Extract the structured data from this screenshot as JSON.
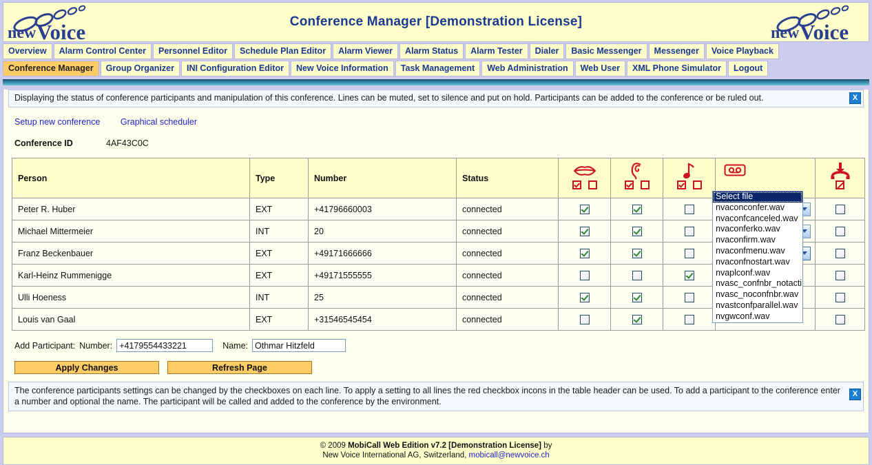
{
  "header": {
    "title": "Conference Manager [Demonstration License]",
    "logo_text_left": "new",
    "logo_text_right": "Voice",
    "logo_alt": "newVoice"
  },
  "nav": {
    "row1": [
      {
        "label": "Overview",
        "active": false
      },
      {
        "label": "Alarm Control Center",
        "active": false
      },
      {
        "label": "Personnel Editor",
        "active": false
      },
      {
        "label": "Schedule Plan Editor",
        "active": false
      },
      {
        "label": "Alarm Viewer",
        "active": false
      },
      {
        "label": "Alarm Status",
        "active": false
      },
      {
        "label": "Alarm Tester",
        "active": false
      },
      {
        "label": "Dialer",
        "active": false
      },
      {
        "label": "Basic Messenger",
        "active": false
      },
      {
        "label": "Messenger",
        "active": false
      },
      {
        "label": "Voice Playback",
        "active": false
      }
    ],
    "row2": [
      {
        "label": "Conference Manager",
        "active": true
      },
      {
        "label": "Group Organizer",
        "active": false
      },
      {
        "label": "INI Configuration Editor",
        "active": false
      },
      {
        "label": "New Voice Information",
        "active": false
      },
      {
        "label": "Task Management",
        "active": false
      },
      {
        "label": "Web Administration",
        "active": false
      },
      {
        "label": "Web User",
        "active": false
      },
      {
        "label": "XML Phone Simulator",
        "active": false
      },
      {
        "label": "Logout",
        "active": false
      }
    ]
  },
  "info_banner": {
    "text": "Displaying the status of conference participants and manipulation of this conference. Lines can be muted, set to silence and put on hold. Participants can be added to the conference or be ruled out.",
    "close_label": "X"
  },
  "links": {
    "setup_new_conference": "Setup new conference",
    "graphical_scheduler": "Graphical scheduler"
  },
  "conference": {
    "id_label": "Conference ID",
    "id_value": "4AF43C0C"
  },
  "table": {
    "columns": [
      "Person",
      "Type",
      "Number",
      "Status"
    ],
    "icon_columns": [
      {
        "name": "mouth-icon",
        "title": "mute",
        "boxes": [
          "checked",
          "empty"
        ]
      },
      {
        "name": "ear-icon",
        "title": "silence",
        "boxes": [
          "checked",
          "empty"
        ]
      },
      {
        "name": "music-note-icon",
        "title": "hold",
        "boxes": [
          "checked",
          "empty"
        ]
      },
      {
        "name": "cassette-tape-icon",
        "title": "play file",
        "boxes": []
      },
      {
        "name": "hangup-phone-icon",
        "title": "rule out",
        "boxes": [
          "slash"
        ]
      }
    ],
    "rows": [
      {
        "person": "Peter R. Huber",
        "type": "EXT",
        "number": "+41796660003",
        "status": "connected",
        "mute": true,
        "silence": true,
        "hold": false,
        "file": "Select file",
        "hangup": false
      },
      {
        "person": "Michael Mittermeier",
        "type": "INT",
        "number": "20",
        "status": "connected",
        "mute": true,
        "silence": true,
        "hold": false,
        "file": "Select file",
        "hangup": false
      },
      {
        "person": "Franz Beckenbauer",
        "type": "EXT",
        "number": "+49171666666",
        "status": "connected",
        "mute": true,
        "silence": true,
        "hold": false,
        "file": "Select file",
        "hangup": false
      },
      {
        "person": "Karl-Heinz Rummenigge",
        "type": "EXT",
        "number": "+49171555555",
        "status": "connected",
        "mute": false,
        "silence": false,
        "hold": true,
        "file": "Select file",
        "hangup": false
      },
      {
        "person": "Ulli Hoeness",
        "type": "INT",
        "number": "25",
        "status": "connected",
        "mute": true,
        "silence": true,
        "hold": false,
        "file": "Select file",
        "hangup": false
      },
      {
        "person": "Louis van Gaal",
        "type": "EXT",
        "number": "+31546545454",
        "status": "connected",
        "mute": false,
        "silence": true,
        "hold": false,
        "file": "Select file",
        "hangup": false
      }
    ]
  },
  "file_dropdown": {
    "open_on_row": 3,
    "selected": "Select file",
    "options": [
      "Select file",
      "nvaconconfer.wav",
      "nvaconfcanceled.wav",
      "nvaconferko.wav",
      "nvaconfirm.wav",
      "nvaconfmenu.wav",
      "nvaconfnostart.wav",
      "nvaplconf.wav",
      "nvasc_confnbr_notacti",
      "nvasc_noconfnbr.wav",
      "nvastconfparallel.wav",
      "nvgwconf.wav"
    ]
  },
  "add_participant": {
    "prefix_label": "Add Participant:",
    "number_label": "Number:",
    "number_value": "+4179554433221",
    "number_placeholder": "",
    "name_label": "Name:",
    "name_value": "Othmar Hitzfeld",
    "name_placeholder": ""
  },
  "buttons": {
    "apply": "Apply Changes",
    "refresh": "Refresh Page"
  },
  "help_banner": {
    "text": "The conference participants settings can be changed by the checkboxes on each line. To apply a setting to all lines the red checkbox incons in the table header can be used. To add a participant to the conference enter a number and optional the name. The participant will be called and added to the conference by the environment.",
    "close_label": "X"
  },
  "footer": {
    "line1_prefix": "© 2009 ",
    "line1_bold": "MobiCall Web Edition v7.2 [Demonstration License]",
    "line1_suffix": " by",
    "line2_prefix": "New Voice International AG, Switzerland, ",
    "line2_email": "mobicall@newvoice.ch"
  },
  "colors": {
    "header_bg": "#ffffcc",
    "brand_blue": "#1a3a8f",
    "active_tab": "#ffcc66",
    "page_bg": "#ccccee",
    "panel_bg": "#ffffee",
    "icon_red": "#cc1122",
    "link_blue": "#2222cc",
    "teal_bar": "#2e7d9a"
  }
}
